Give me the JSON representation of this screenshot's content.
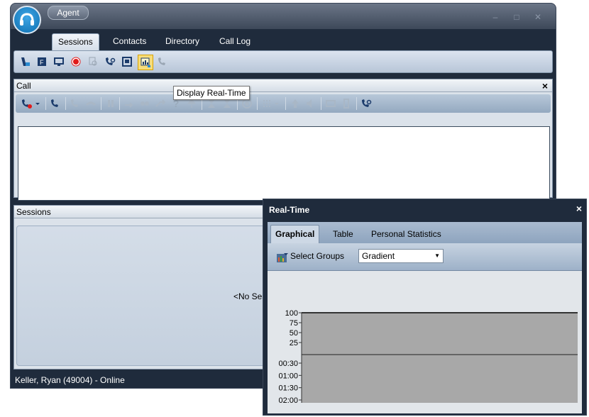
{
  "app": {
    "tab_label": "Agent"
  },
  "window_controls": [
    "–",
    "□",
    "✕"
  ],
  "nav": {
    "tabs": [
      "Sessions",
      "Contacts",
      "Directory",
      "Call Log"
    ],
    "active": "Sessions"
  },
  "toolbar": {
    "icons": [
      "agent-walk-icon",
      "form-icon",
      "monitor-icon",
      "record-icon",
      "magnify-icon",
      "phone-search-icon",
      "window-icon",
      "display-realtime-icon",
      "phone-gray-icon"
    ],
    "active_icon": "display-realtime-icon"
  },
  "tooltip": {
    "text": "Display Real-Time"
  },
  "call_panel": {
    "title": "Call",
    "close": "×"
  },
  "sessions_panel": {
    "title": "Sessions",
    "empty_text": "<No Ses"
  },
  "status": {
    "text": "Keller, Ryan (49004)  - Online"
  },
  "realtime": {
    "title": "Real-Time",
    "close": "×",
    "tabs": [
      "Graphical",
      "Table",
      "Personal Statistics"
    ],
    "active_tab": "Graphical",
    "select_groups_label": "Select Groups",
    "dropdown_value": "Gradient"
  },
  "chart_data": {
    "type": "bar",
    "top_ticks": [
      "100",
      "75",
      "50",
      "25"
    ],
    "bottom_ticks": [
      "00:30",
      "01:00",
      "01:30",
      "02:00"
    ],
    "series": [],
    "colors": {
      "plot_bg": "#a8a8a8",
      "axis": "#333333"
    }
  },
  "colors": {
    "chrome_dark": "#1f2b3c",
    "accent_blue": "#0d6fb0",
    "highlight": "#f6dc7a"
  }
}
